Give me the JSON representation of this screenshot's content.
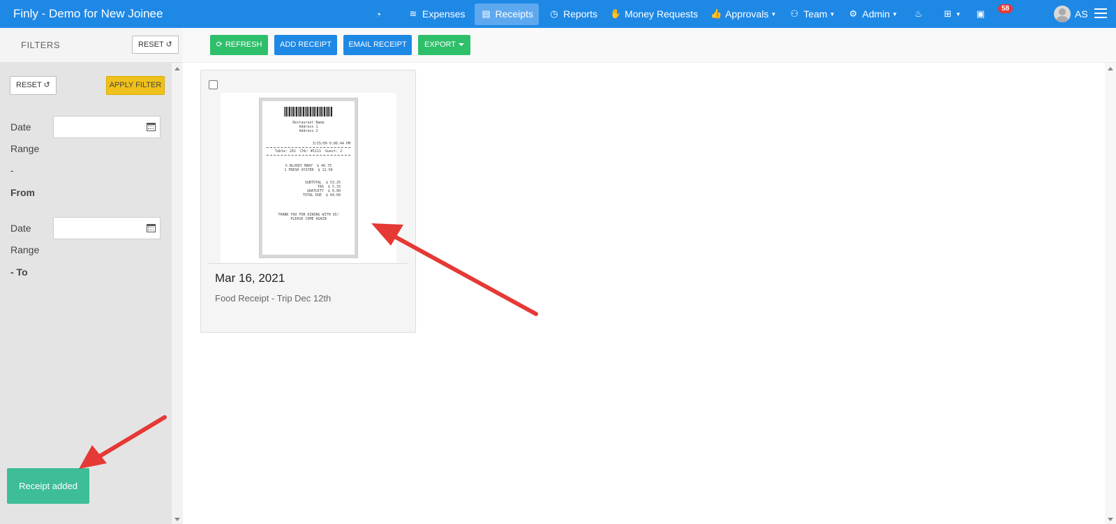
{
  "navbar": {
    "brand": "Finly - Demo for New Joinee",
    "items": [
      {
        "label": "",
        "icon": "dashboard-icon"
      },
      {
        "label": "Expenses",
        "icon": "coins-icon"
      },
      {
        "label": "Receipts",
        "icon": "receipt-icon",
        "active": true
      },
      {
        "label": "Reports",
        "icon": "pie-chart-icon"
      },
      {
        "label": "Money Requests",
        "icon": "hand-money-icon"
      },
      {
        "label": "Approvals",
        "icon": "thumbs-up-icon",
        "dropdown": true
      },
      {
        "label": "Team",
        "icon": "team-icon",
        "dropdown": true
      },
      {
        "label": "Admin",
        "icon": "user-gear-icon",
        "dropdown": true
      },
      {
        "label": "",
        "icon": "cake-icon"
      },
      {
        "label": "",
        "icon": "plus-square-icon",
        "dropdown": true
      },
      {
        "label": "",
        "icon": "inbox-icon"
      }
    ],
    "inbox_count": "58",
    "user_initials": "AS"
  },
  "sidebar": {
    "title": "FILTERS",
    "reset_label": "RESET",
    "apply_label": "APPLY FILTER",
    "date_from_label": [
      "Date",
      "Range",
      "-",
      "From"
    ],
    "date_to_label": [
      "Date",
      "Range",
      "- To"
    ]
  },
  "toolbar": {
    "refresh": "REFRESH",
    "add_receipt": "ADD RECEIPT",
    "email_receipt": "EMAIL RECEIPT",
    "export": "EXPORT"
  },
  "receipt_card": {
    "date": "Mar 16, 2021",
    "description": "Food Receipt - Trip Dec 12th",
    "image": {
      "header": [
        "Restaurant Name",
        "Address 1",
        "Address 2"
      ],
      "datetime": "3/15/09 6:06:44 PM",
      "table_line": "Table: 201  Chk: #1111  Guest: 2",
      "items": [
        "5 BLOODY MARY  $ 40.75",
        "1 FRESH OYSTER  $ 12.50"
      ],
      "totals": [
        "SUBTOTAL  $ 53.25",
        "TAX  $ 5.33",
        "GRATUITY  $ 6.00",
        "TOTAL DUE  $ 64.60"
      ],
      "footer": [
        "THANK YOU FOR DINING WITH US!",
        "PLEASE COME AGAIN"
      ]
    }
  },
  "toast": {
    "message": "Receipt added"
  },
  "colors": {
    "navbar": "#1e88e5",
    "active_nav": "#5da8ef",
    "green_button": "#2ebf6b",
    "blue_button": "#1e88e5",
    "apply_button": "#f0c11a",
    "toast": "#3dbd98",
    "badge": "#e53935",
    "annotation_arrow": "#e53935"
  }
}
